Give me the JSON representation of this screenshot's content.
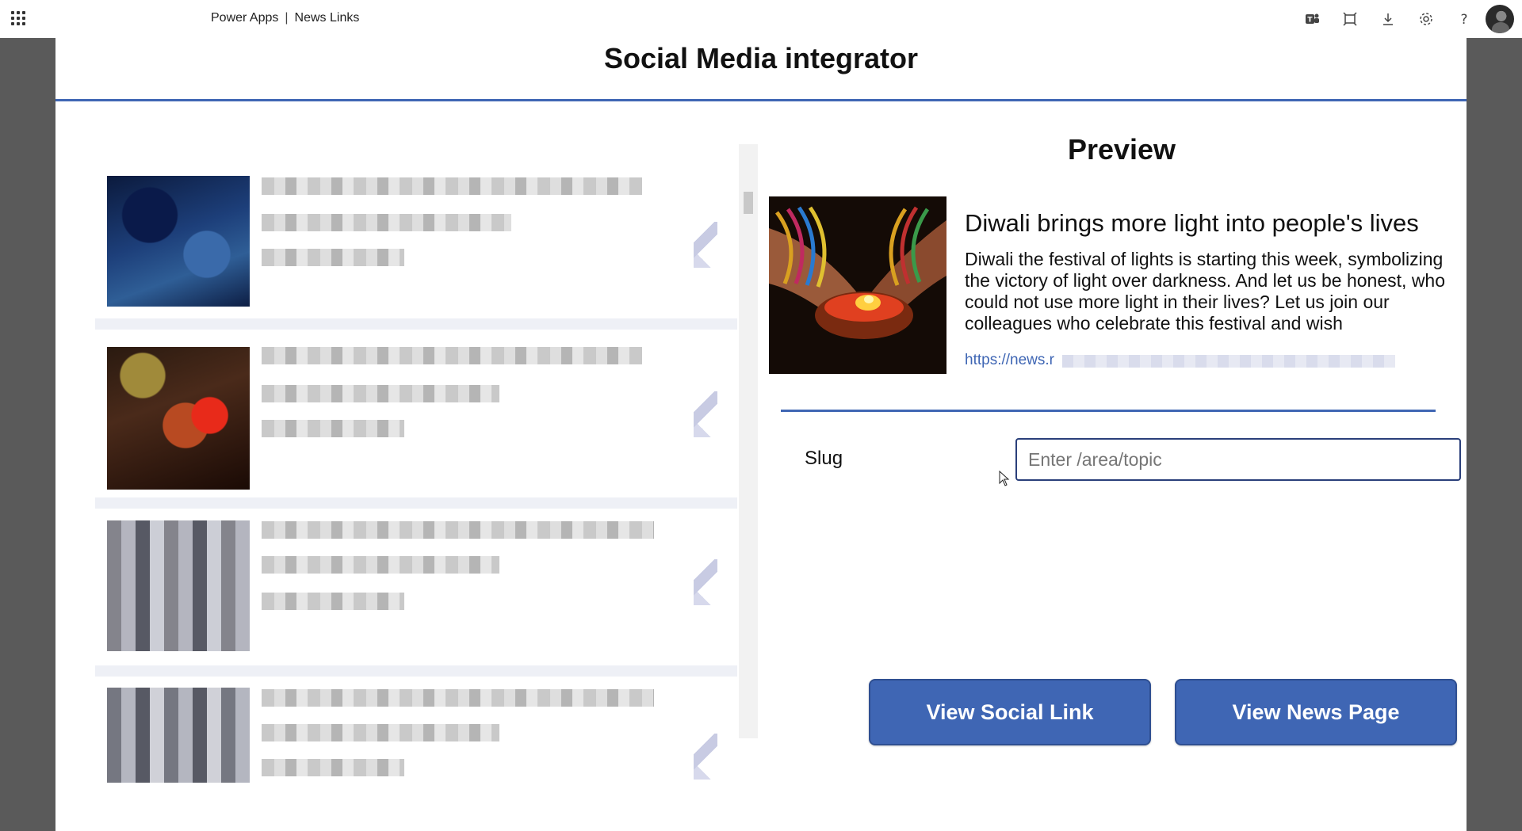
{
  "topbar": {
    "app_name": "Power Apps",
    "separator": "|",
    "app_title": "News Links",
    "icons": [
      "waffle-icon",
      "teams-icon",
      "fit-to-window-icon",
      "download-icon",
      "settings-icon",
      "help-icon"
    ]
  },
  "canvas": {
    "title": "Social Media integrator"
  },
  "gallery": {
    "items": [
      {
        "thumb": "blue-abstract",
        "state": "blurred"
      },
      {
        "thumb": "diwali-lamp",
        "state": "blurred"
      },
      {
        "thumb": "grey-people",
        "state": "blurred"
      },
      {
        "thumb": "grey-people",
        "state": "blurred"
      }
    ]
  },
  "preview": {
    "heading": "Preview",
    "title": "Diwali brings more light into people's lives",
    "body": "Diwali the festival of lights is starting this week, symbolizing the victory of light over darkness. And let us be honest, who could not use more light in their lives? Let us join our colleagues who celebrate this festival and wish",
    "link_visible": "https://news.r"
  },
  "form": {
    "slug_label": "Slug",
    "slug_value": "",
    "slug_placeholder": "Enter /area/topic"
  },
  "buttons": {
    "view_social": "View Social Link",
    "view_news": "View News Page"
  },
  "colors": {
    "accent": "#3f66b4",
    "outer_background": "#5a5a5a",
    "input_border": "#2a3f7a"
  }
}
